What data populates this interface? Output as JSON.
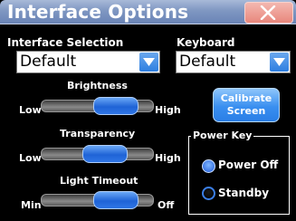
{
  "window": {
    "title": "Interface Options"
  },
  "interface_selection": {
    "label": "Interface Selection",
    "value": "Default"
  },
  "keyboard": {
    "label": "Keyboard",
    "value": "Default"
  },
  "brightness": {
    "label": "Brightness",
    "min_label": "Low",
    "max_label": "High",
    "level": 0.78
  },
  "transparency": {
    "label": "Transparency",
    "min_label": "Low",
    "max_label": "High",
    "level": 0.62
  },
  "light_timeout": {
    "label": "Light Timeout",
    "min_label": "Min",
    "max_label": "Off",
    "level": 0.78
  },
  "calibrate": {
    "line1": "Calibrate",
    "line2": "Screen"
  },
  "power_key": {
    "legend": "Power Key",
    "options": [
      {
        "label": "Power Off",
        "selected": true
      },
      {
        "label": "Standby",
        "selected": false
      }
    ]
  },
  "colors": {
    "accent": "#2d7ee0",
    "titlebar": "#7f97c2",
    "close": "#e8877d"
  }
}
